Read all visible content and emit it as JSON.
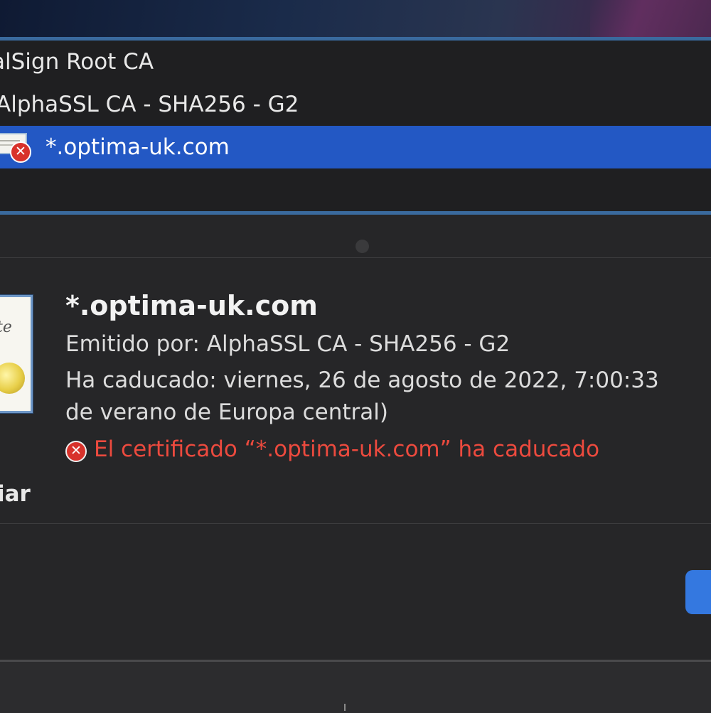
{
  "chain": {
    "items": [
      {
        "label": "alSign Root CA"
      },
      {
        "label": "AlphaSSL CA - SHA256 - G2"
      },
      {
        "label": "*.optima-uk.com",
        "selected": true,
        "status": "error"
      }
    ]
  },
  "details": {
    "title": "*.optima-uk.com",
    "issued_by": "Emitido por: AlphaSSL CA - SHA256 - G2",
    "expired_line1": "Ha caducado: viernes, 26 de agosto de 2022, 7:00:33",
    "expired_line2": "de verano de Europa central)",
    "error_message": "El certificado “*.optima-uk.com” ha caducado",
    "error_symbol": "✕"
  },
  "trust_section": {
    "label": "iar"
  },
  "colors": {
    "selection": "#2358c4",
    "error": "#ec4a3e",
    "accent_button": "#3478e0",
    "panel_border": "#3a6a9e"
  },
  "icons": {
    "cert_small": "certificate-icon",
    "cert_large": "certificate-large-icon",
    "error": "error-x-icon"
  }
}
